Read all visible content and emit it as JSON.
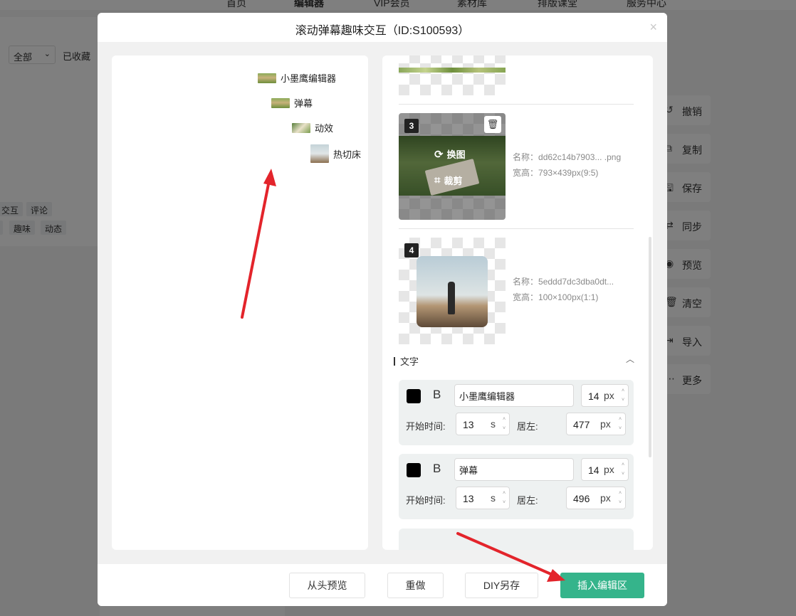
{
  "background": {
    "nav_items": [
      "首页",
      "编辑器",
      "VIP会员",
      "素材库",
      "排版课堂",
      "服务中心"
    ],
    "filter_select": "全部",
    "favorites_label": "已收藏",
    "tags_row1": [
      "交互",
      "评论"
    ],
    "tags_row2": [
      "趣味",
      "动态"
    ],
    "tools": [
      {
        "icon": "undo-icon",
        "glyph": "↺",
        "label": "撤销"
      },
      {
        "icon": "copy-icon",
        "glyph": "⧉",
        "label": "复制"
      },
      {
        "icon": "save-icon",
        "glyph": "🖫",
        "label": "保存"
      },
      {
        "icon": "sync-icon",
        "glyph": "⇄",
        "label": "同步"
      },
      {
        "icon": "preview-icon",
        "glyph": "◉",
        "label": "预览"
      },
      {
        "icon": "clear-icon",
        "glyph": "🗑",
        "label": "清空"
      },
      {
        "icon": "import-icon",
        "glyph": "⇥",
        "label": "导入"
      },
      {
        "icon": "more-icon",
        "glyph": "⋯",
        "label": "更多"
      }
    ]
  },
  "modal": {
    "title": "滚动弹幕趣味交互（ID:S100593）",
    "close_glyph": "×"
  },
  "preview": {
    "danmaku": [
      {
        "text": "小墨鹰编辑器",
        "thumb": "grass"
      },
      {
        "text": "弹幕",
        "thumb": "grass"
      },
      {
        "text": "动效",
        "thumb": "notes"
      },
      {
        "text": "热切床",
        "thumb": "guitar"
      }
    ]
  },
  "images": [
    {
      "index": "3",
      "name_label": "名称：",
      "name": "dd62c14b7903... .png",
      "size_label": "宽高：",
      "size": "793×439px(9:5)",
      "replace_label": "换图",
      "crop_label": "裁剪",
      "delete_icon": "trash-icon"
    },
    {
      "index": "4",
      "name_label": "名称：",
      "name": "5eddd7dc3dba0dt...",
      "size_label": "宽高：",
      "size": "100×100px(1:1)"
    }
  ],
  "text_section": {
    "title": "文字",
    "toggle_glyph": "︿",
    "items": [
      {
        "bold_glyph": "B",
        "text": "小墨鹰编辑器",
        "font_size": "14",
        "font_unit": "px",
        "start_label": "开始时间:",
        "start": "13",
        "start_unit": "s",
        "left_label": "居左:",
        "left": "477",
        "left_unit": "px",
        "color": "#000000"
      },
      {
        "bold_glyph": "B",
        "text": "弹幕",
        "font_size": "14",
        "font_unit": "px",
        "start_label": "开始时间:",
        "start": "13",
        "start_unit": "s",
        "left_label": "居左:",
        "left": "496",
        "left_unit": "px",
        "color": "#000000"
      }
    ]
  },
  "footer": {
    "replay": "从头预览",
    "redo": "重做",
    "save_as": "DIY另存",
    "insert": "插入编辑区"
  },
  "colors": {
    "primary": "#35b48b",
    "annotation": "#e3242b"
  }
}
